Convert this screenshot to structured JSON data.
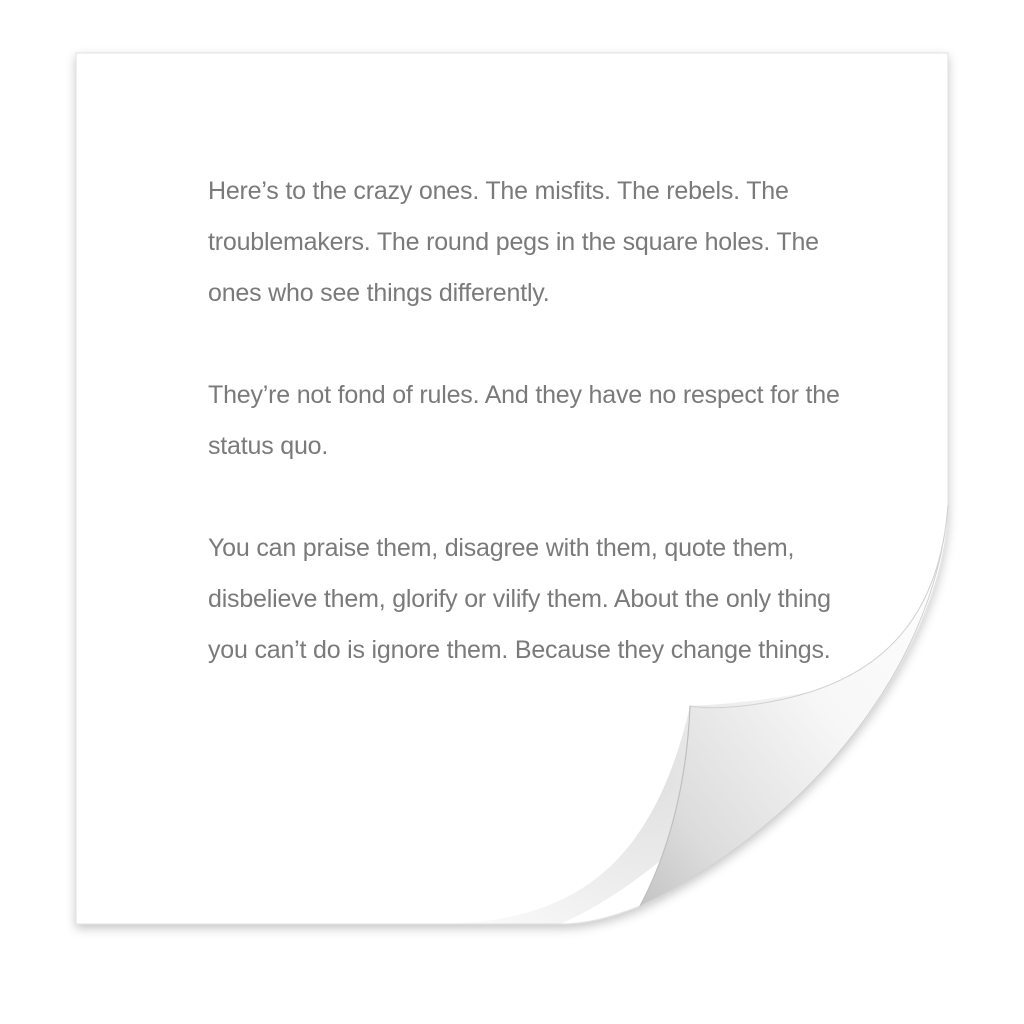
{
  "document": {
    "paragraphs": [
      "Here’s to the crazy ones. The misfits. The rebels. The troublemakers. The round pegs in the square holes. The ones who see things differently.",
      "They’re not fond of rules. And they have no respect for the status quo.",
      "You can praise them, disagree with them, quote them, disbelieve them, glorify or vilify them. About the only thing you can’t do is ignore them. Because they change things."
    ]
  },
  "colors": {
    "text": "#7a7a7a",
    "paper": "#ffffff",
    "shadow": "#000000"
  },
  "icon": "page-curl-document-icon"
}
